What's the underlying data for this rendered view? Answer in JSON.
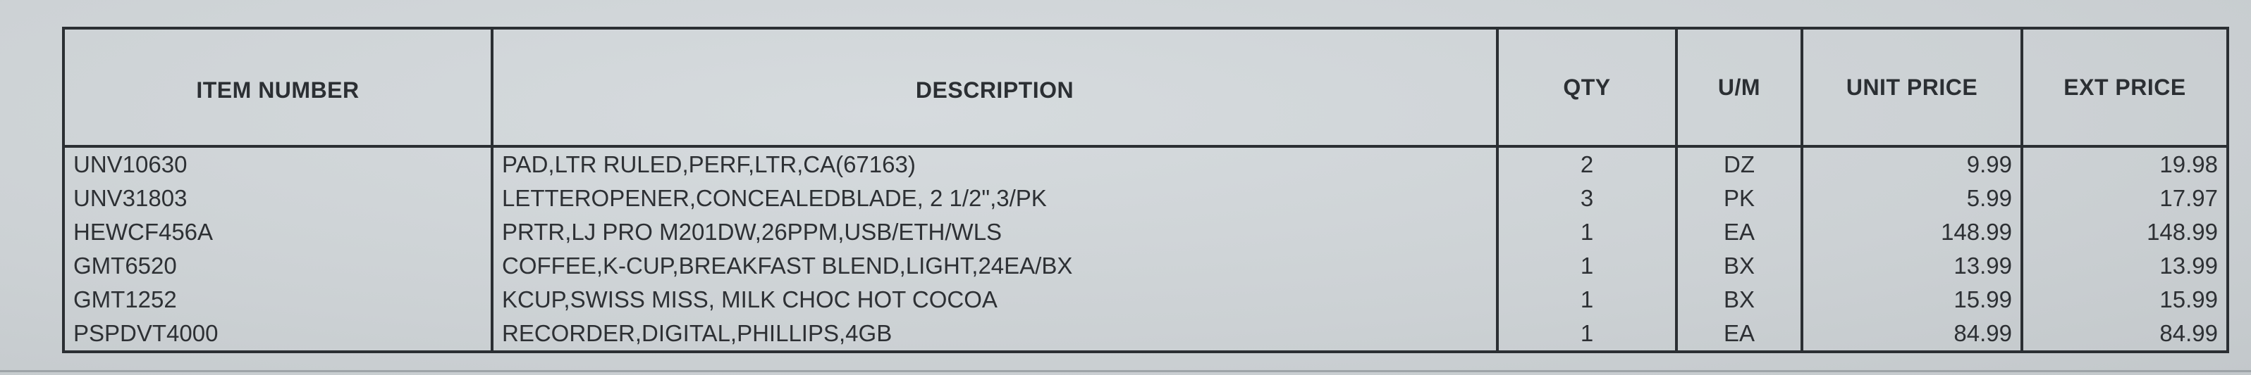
{
  "columns": {
    "item_number": "ITEM NUMBER",
    "description": "DESCRIPTION",
    "qty": "QTY",
    "um": "U/M",
    "unit_price": "UNIT PRICE",
    "ext_price": "EXT PRICE"
  },
  "rows": [
    {
      "item": "UNV10630",
      "description": "PAD,LTR RULED,PERF,LTR,CA(67163)",
      "qty": "2",
      "um": "DZ",
      "unit_price": "9.99",
      "ext_price": "19.98"
    },
    {
      "item": "UNV31803",
      "description": "LETTEROPENER,CONCEALEDBLADE, 2 1/2\",3/PK",
      "qty": "3",
      "um": "PK",
      "unit_price": "5.99",
      "ext_price": "17.97"
    },
    {
      "item": "HEWCF456A",
      "description": "PRTR,LJ PRO M201DW,26PPM,USB/ETH/WLS",
      "qty": "1",
      "um": "EA",
      "unit_price": "148.99",
      "ext_price": "148.99"
    },
    {
      "item": "GMT6520",
      "description": "COFFEE,K-CUP,BREAKFAST BLEND,LIGHT,24EA/BX",
      "qty": "1",
      "um": "BX",
      "unit_price": "13.99",
      "ext_price": "13.99"
    },
    {
      "item": "GMT1252",
      "description": "KCUP,SWISS MISS, MILK CHOC HOT COCOA",
      "qty": "1",
      "um": "BX",
      "unit_price": "15.99",
      "ext_price": "15.99"
    },
    {
      "item": "PSPDVT4000",
      "description": "RECORDER,DIGITAL,PHILLIPS,4GB",
      "qty": "1",
      "um": "EA",
      "unit_price": "84.99",
      "ext_price": "84.99"
    }
  ]
}
